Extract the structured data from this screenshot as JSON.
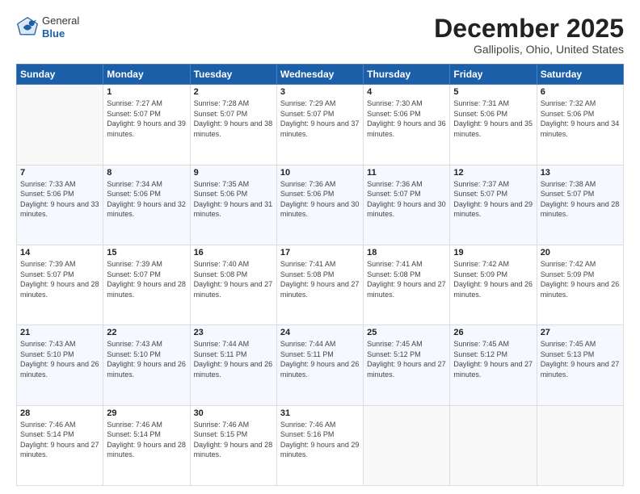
{
  "header": {
    "logo": {
      "general": "General",
      "blue": "Blue"
    },
    "title": "December 2025",
    "subtitle": "Gallipolis, Ohio, United States"
  },
  "calendar": {
    "days_of_week": [
      "Sunday",
      "Monday",
      "Tuesday",
      "Wednesday",
      "Thursday",
      "Friday",
      "Saturday"
    ],
    "weeks": [
      [
        {
          "day": "",
          "sunrise": "",
          "sunset": "",
          "daylight": ""
        },
        {
          "day": "1",
          "sunrise": "Sunrise: 7:27 AM",
          "sunset": "Sunset: 5:07 PM",
          "daylight": "Daylight: 9 hours and 39 minutes."
        },
        {
          "day": "2",
          "sunrise": "Sunrise: 7:28 AM",
          "sunset": "Sunset: 5:07 PM",
          "daylight": "Daylight: 9 hours and 38 minutes."
        },
        {
          "day": "3",
          "sunrise": "Sunrise: 7:29 AM",
          "sunset": "Sunset: 5:07 PM",
          "daylight": "Daylight: 9 hours and 37 minutes."
        },
        {
          "day": "4",
          "sunrise": "Sunrise: 7:30 AM",
          "sunset": "Sunset: 5:06 PM",
          "daylight": "Daylight: 9 hours and 36 minutes."
        },
        {
          "day": "5",
          "sunrise": "Sunrise: 7:31 AM",
          "sunset": "Sunset: 5:06 PM",
          "daylight": "Daylight: 9 hours and 35 minutes."
        },
        {
          "day": "6",
          "sunrise": "Sunrise: 7:32 AM",
          "sunset": "Sunset: 5:06 PM",
          "daylight": "Daylight: 9 hours and 34 minutes."
        }
      ],
      [
        {
          "day": "7",
          "sunrise": "Sunrise: 7:33 AM",
          "sunset": "Sunset: 5:06 PM",
          "daylight": "Daylight: 9 hours and 33 minutes."
        },
        {
          "day": "8",
          "sunrise": "Sunrise: 7:34 AM",
          "sunset": "Sunset: 5:06 PM",
          "daylight": "Daylight: 9 hours and 32 minutes."
        },
        {
          "day": "9",
          "sunrise": "Sunrise: 7:35 AM",
          "sunset": "Sunset: 5:06 PM",
          "daylight": "Daylight: 9 hours and 31 minutes."
        },
        {
          "day": "10",
          "sunrise": "Sunrise: 7:36 AM",
          "sunset": "Sunset: 5:06 PM",
          "daylight": "Daylight: 9 hours and 30 minutes."
        },
        {
          "day": "11",
          "sunrise": "Sunrise: 7:36 AM",
          "sunset": "Sunset: 5:07 PM",
          "daylight": "Daylight: 9 hours and 30 minutes."
        },
        {
          "day": "12",
          "sunrise": "Sunrise: 7:37 AM",
          "sunset": "Sunset: 5:07 PM",
          "daylight": "Daylight: 9 hours and 29 minutes."
        },
        {
          "day": "13",
          "sunrise": "Sunrise: 7:38 AM",
          "sunset": "Sunset: 5:07 PM",
          "daylight": "Daylight: 9 hours and 28 minutes."
        }
      ],
      [
        {
          "day": "14",
          "sunrise": "Sunrise: 7:39 AM",
          "sunset": "Sunset: 5:07 PM",
          "daylight": "Daylight: 9 hours and 28 minutes."
        },
        {
          "day": "15",
          "sunrise": "Sunrise: 7:39 AM",
          "sunset": "Sunset: 5:07 PM",
          "daylight": "Daylight: 9 hours and 28 minutes."
        },
        {
          "day": "16",
          "sunrise": "Sunrise: 7:40 AM",
          "sunset": "Sunset: 5:08 PM",
          "daylight": "Daylight: 9 hours and 27 minutes."
        },
        {
          "day": "17",
          "sunrise": "Sunrise: 7:41 AM",
          "sunset": "Sunset: 5:08 PM",
          "daylight": "Daylight: 9 hours and 27 minutes."
        },
        {
          "day": "18",
          "sunrise": "Sunrise: 7:41 AM",
          "sunset": "Sunset: 5:08 PM",
          "daylight": "Daylight: 9 hours and 27 minutes."
        },
        {
          "day": "19",
          "sunrise": "Sunrise: 7:42 AM",
          "sunset": "Sunset: 5:09 PM",
          "daylight": "Daylight: 9 hours and 26 minutes."
        },
        {
          "day": "20",
          "sunrise": "Sunrise: 7:42 AM",
          "sunset": "Sunset: 5:09 PM",
          "daylight": "Daylight: 9 hours and 26 minutes."
        }
      ],
      [
        {
          "day": "21",
          "sunrise": "Sunrise: 7:43 AM",
          "sunset": "Sunset: 5:10 PM",
          "daylight": "Daylight: 9 hours and 26 minutes."
        },
        {
          "day": "22",
          "sunrise": "Sunrise: 7:43 AM",
          "sunset": "Sunset: 5:10 PM",
          "daylight": "Daylight: 9 hours and 26 minutes."
        },
        {
          "day": "23",
          "sunrise": "Sunrise: 7:44 AM",
          "sunset": "Sunset: 5:11 PM",
          "daylight": "Daylight: 9 hours and 26 minutes."
        },
        {
          "day": "24",
          "sunrise": "Sunrise: 7:44 AM",
          "sunset": "Sunset: 5:11 PM",
          "daylight": "Daylight: 9 hours and 26 minutes."
        },
        {
          "day": "25",
          "sunrise": "Sunrise: 7:45 AM",
          "sunset": "Sunset: 5:12 PM",
          "daylight": "Daylight: 9 hours and 27 minutes."
        },
        {
          "day": "26",
          "sunrise": "Sunrise: 7:45 AM",
          "sunset": "Sunset: 5:12 PM",
          "daylight": "Daylight: 9 hours and 27 minutes."
        },
        {
          "day": "27",
          "sunrise": "Sunrise: 7:45 AM",
          "sunset": "Sunset: 5:13 PM",
          "daylight": "Daylight: 9 hours and 27 minutes."
        }
      ],
      [
        {
          "day": "28",
          "sunrise": "Sunrise: 7:46 AM",
          "sunset": "Sunset: 5:14 PM",
          "daylight": "Daylight: 9 hours and 27 minutes."
        },
        {
          "day": "29",
          "sunrise": "Sunrise: 7:46 AM",
          "sunset": "Sunset: 5:14 PM",
          "daylight": "Daylight: 9 hours and 28 minutes."
        },
        {
          "day": "30",
          "sunrise": "Sunrise: 7:46 AM",
          "sunset": "Sunset: 5:15 PM",
          "daylight": "Daylight: 9 hours and 28 minutes."
        },
        {
          "day": "31",
          "sunrise": "Sunrise: 7:46 AM",
          "sunset": "Sunset: 5:16 PM",
          "daylight": "Daylight: 9 hours and 29 minutes."
        },
        {
          "day": "",
          "sunrise": "",
          "sunset": "",
          "daylight": ""
        },
        {
          "day": "",
          "sunrise": "",
          "sunset": "",
          "daylight": ""
        },
        {
          "day": "",
          "sunrise": "",
          "sunset": "",
          "daylight": ""
        }
      ]
    ]
  }
}
